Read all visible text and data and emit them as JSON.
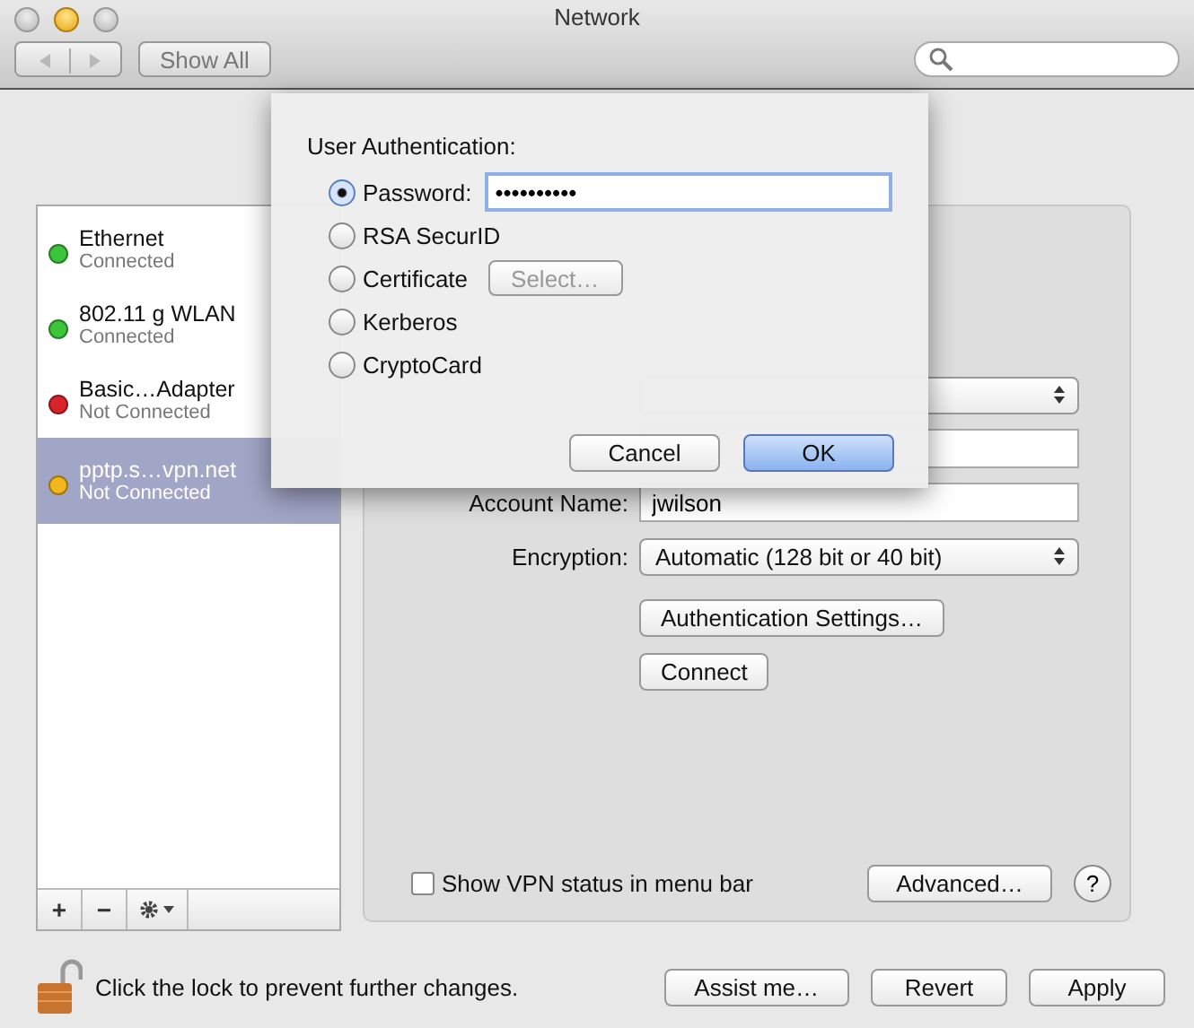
{
  "window": {
    "title": "Network"
  },
  "toolbar": {
    "show_all": "Show All"
  },
  "services": [
    {
      "name": "Ethernet",
      "status": "Connected",
      "color": "#3cc43a",
      "selected": false
    },
    {
      "name": "802.11 g WLAN",
      "status": "Connected",
      "color": "#3cc43a",
      "selected": false
    },
    {
      "name": "Basic…Adapter",
      "status": "Not Connected",
      "color": "#d8232a",
      "selected": false
    },
    {
      "name": "pptp.s…vpn.net",
      "status": "Not Connected",
      "color": "#f0b81c",
      "selected": true
    }
  ],
  "service_actions": [
    "+",
    "−"
  ],
  "panel": {
    "rows": [
      {
        "kind": "select"
      },
      {
        "kind": "text"
      },
      {
        "kind": "text",
        "label": "Account Name:",
        "value": "jwilson"
      },
      {
        "kind": "select",
        "label": "Encryption:",
        "value": "Automatic (128 bit or 40 bit)"
      },
      {
        "kind": "button",
        "label": "Authentication Settings…"
      },
      {
        "kind": "button",
        "label": "Connect"
      }
    ],
    "show_status": {
      "label": "Show VPN status in menu bar",
      "checked": false
    },
    "advanced": "Advanced…",
    "help": "?"
  },
  "sheet": {
    "title": "User Authentication:",
    "options": [
      {
        "label": "Password:",
        "selected": true,
        "kind": "field",
        "value": "••••••••••"
      },
      {
        "label": "RSA SecurID",
        "selected": false,
        "kind": "plain"
      },
      {
        "label": "Certificate",
        "selected": false,
        "kind": "button",
        "button": "Select…",
        "disabled": true
      },
      {
        "label": "Kerberos",
        "selected": false,
        "kind": "plain"
      },
      {
        "label": "CryptoCard",
        "selected": false,
        "kind": "plain"
      }
    ],
    "buttons": [
      {
        "label": "Cancel",
        "default": false
      },
      {
        "label": "OK",
        "default": true
      }
    ]
  },
  "footer": {
    "lock_text": "Click the lock to prevent further changes.",
    "buttons": [
      "Assist me…",
      "Revert",
      "Apply"
    ]
  }
}
